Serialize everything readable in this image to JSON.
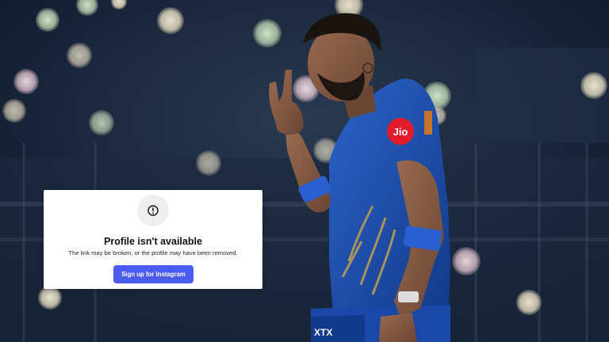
{
  "dialog": {
    "title": "Profile isn't available",
    "message": "The link may be broken, or the profile may have been removed.",
    "button_label": "Sign up for Instagram",
    "icon": "alert-circle-icon"
  },
  "photo": {
    "jersey_logo": "Jio",
    "icon": "photo-background"
  },
  "colors": {
    "button": "#4a5cf0",
    "dialog_background": "#ffffff",
    "icon_circle": "#efefef",
    "jersey": "#1f4fae"
  }
}
